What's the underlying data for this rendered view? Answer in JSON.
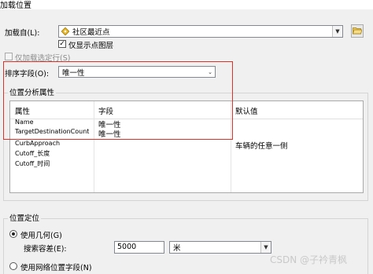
{
  "window": {
    "title": "加载位置"
  },
  "load_from": {
    "label": "加载自(L):",
    "value": "社区最近点",
    "icon": "point-layer-icon"
  },
  "show_points_only": {
    "label": "仅显示点图层",
    "checked": true
  },
  "load_selected_only": {
    "label": "仅加载选定行(S)",
    "checked": false,
    "enabled": false
  },
  "sort_field": {
    "label": "排序字段(O):",
    "value": "唯一性"
  },
  "location_analysis": {
    "title": "位置分析属性",
    "columns": [
      "属性",
      "字段",
      "默认值"
    ],
    "rows": [
      {
        "property": "Name",
        "field": "唯一性",
        "default": ""
      },
      {
        "property": "TargetDestinationCount",
        "field": "唯一性",
        "default": ""
      },
      {
        "property": "CurbApproach",
        "field": "",
        "default": "车辆的任意一侧"
      },
      {
        "property": "Cutoff_长度",
        "field": "",
        "default": ""
      },
      {
        "property": "Cutoff_时间",
        "field": "",
        "default": ""
      }
    ]
  },
  "location_position": {
    "title": "位置定位",
    "use_geometry": {
      "label": "使用几何(G)",
      "selected": true
    },
    "search_tolerance": {
      "label": "搜索容差(E):",
      "value": "5000",
      "unit": "米"
    },
    "use_network_fields": {
      "label": "使用网络位置字段(N)",
      "selected": false
    }
  },
  "watermark": "CSDN @子衿青枫",
  "colors": {
    "highlight_box": "#d9342b",
    "accent_checkbox": "#000000"
  }
}
